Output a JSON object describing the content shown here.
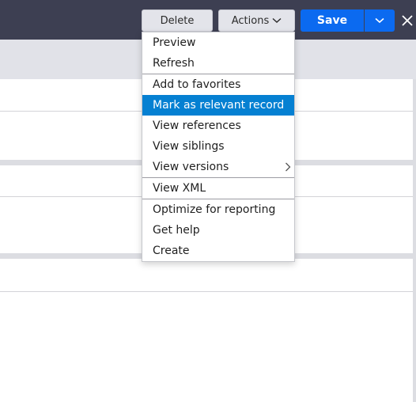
{
  "toolbar": {
    "delete_label": "Delete",
    "actions_label": "Actions",
    "save_label": "Save"
  },
  "icons": {
    "actions_chevron": "chevron-down-icon",
    "save_chevron": "chevron-down-icon",
    "close": "close-icon",
    "submenu_arrow": "chevron-right-icon"
  },
  "colors": {
    "header": "#3d3f52",
    "primary": "#0b6af0",
    "highlight": "#0580d2"
  },
  "menu": {
    "groups": [
      [
        {
          "label": "Preview"
        },
        {
          "label": "Refresh"
        }
      ],
      [
        {
          "label": "Add to favorites"
        },
        {
          "label": "Mark as relevant record",
          "highlighted": true
        },
        {
          "label": "View references"
        },
        {
          "label": "View siblings"
        },
        {
          "label": "View versions",
          "has_submenu": true
        }
      ],
      [
        {
          "label": "View XML"
        }
      ],
      [
        {
          "label": "Optimize for reporting"
        },
        {
          "label": "Get help"
        },
        {
          "label": "Create"
        }
      ]
    ]
  }
}
